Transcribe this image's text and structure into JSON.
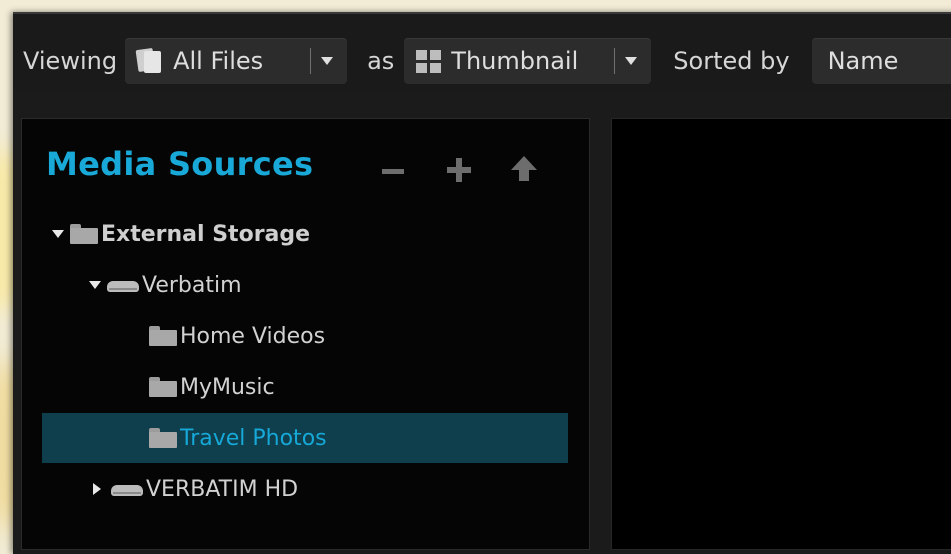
{
  "toolbar": {
    "viewing_label": "Viewing",
    "view_filter": {
      "value": "All Files",
      "icon": "files-icon"
    },
    "as_label": "as",
    "view_mode": {
      "value": "Thumbnail",
      "icon": "grid-icon"
    },
    "sorted_label": "Sorted by",
    "sort_by": {
      "value": "Name"
    }
  },
  "sources_panel": {
    "title": "Media Sources",
    "controls": [
      "remove-icon",
      "add-icon",
      "up-arrow-icon"
    ],
    "tree": [
      {
        "label": "External Storage",
        "icon": "folder-icon",
        "expanded": true,
        "level": 0
      },
      {
        "label": "Verbatim",
        "icon": "drive-icon",
        "expanded": true,
        "level": 1
      },
      {
        "label": "Home Videos",
        "icon": "folder-icon",
        "level": 2
      },
      {
        "label": "MyMusic",
        "icon": "folder-icon",
        "level": 2
      },
      {
        "label": "Travel Photos",
        "icon": "folder-icon",
        "level": 2,
        "selected": true
      },
      {
        "label": "VERBATIM HD",
        "icon": "drive-icon",
        "expanded": false,
        "level": 1
      }
    ]
  },
  "colors": {
    "accent": "#19a9d8",
    "selection_bg": "#0f3e4d",
    "window_bg": "#1b1b1b",
    "panel_bg": "#050505"
  }
}
